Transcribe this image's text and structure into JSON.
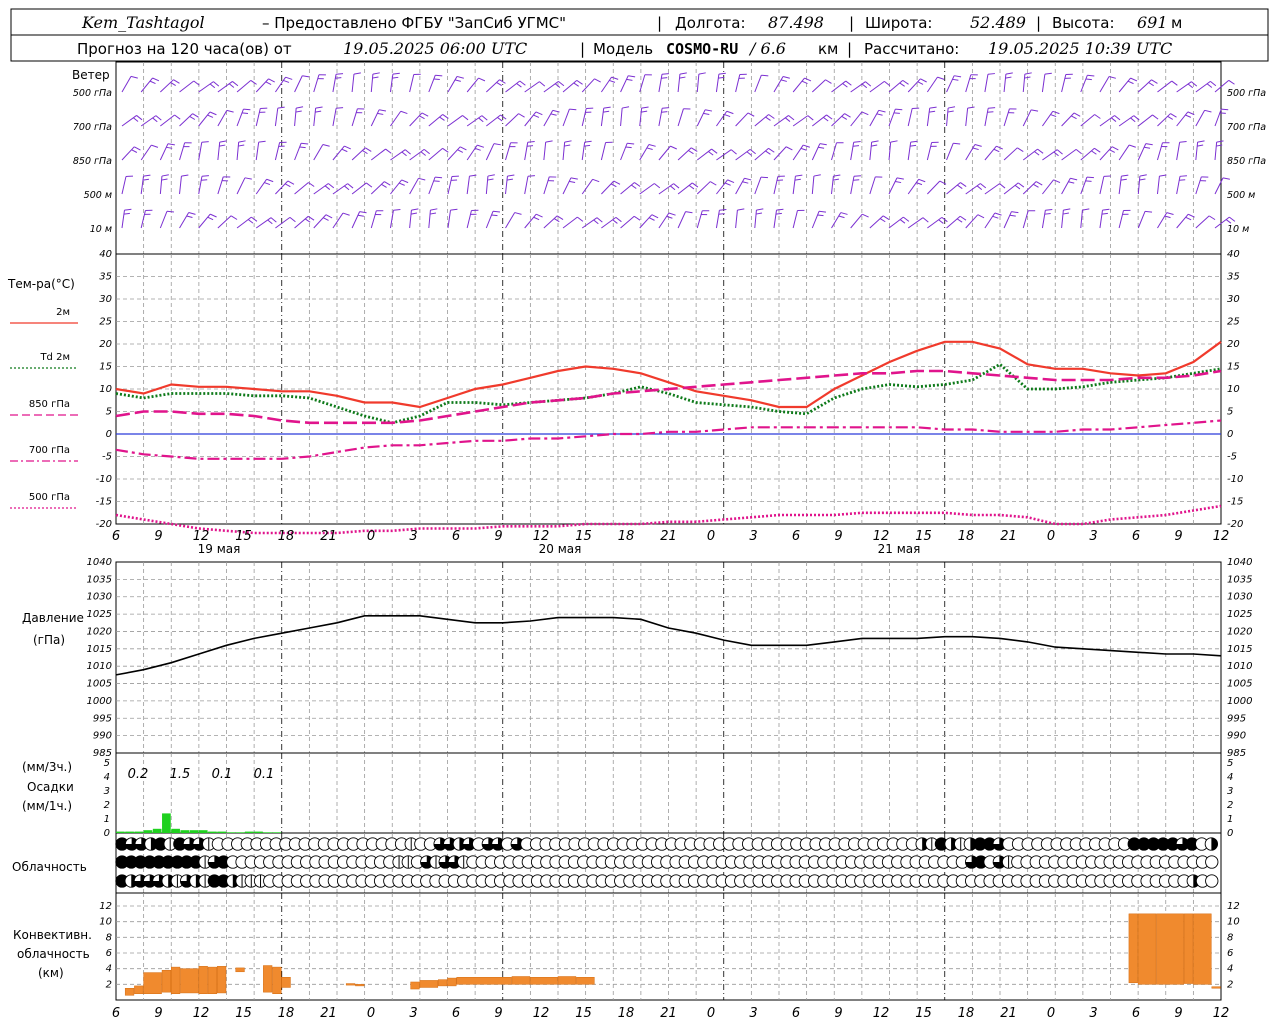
{
  "header": {
    "station": "Kem_Tashtagol",
    "provider": "– Предоставлено ФГБУ \"ЗапСиб УГМС\"",
    "lon_label": "Долгота:",
    "lon_value": "87.498",
    "lat_label": "Широта:",
    "lat_value": "52.489",
    "alt_label": "Высота:",
    "alt_value": "691",
    "alt_unit": "м",
    "forecast_prefix": "Прогноз на 120 часа(ов) от",
    "forecast_start": "19.05.2025 06:00 UTC",
    "model_label": "Модель",
    "model_name": "COSMO-RU",
    "model_res": "/ 6.6",
    "model_res_unit": "км",
    "calc_label": "Рассчитано:",
    "calc_time": "19.05.2025 10:39 UTC"
  },
  "panels": {
    "wind": {
      "title": "Ветер",
      "levels": [
        "500 гПа",
        "700 гПа",
        "850 гПа",
        "500 м",
        "10  м"
      ]
    },
    "temperature": {
      "title": "Тем-ра(°С)",
      "legend": [
        {
          "label": "2м",
          "style": "solid",
          "color": "#f03a2c"
        },
        {
          "label": "Td  2м",
          "style": "dotted-green",
          "color": "#0e7a1a"
        },
        {
          "label": "850 гПа",
          "style": "dash",
          "color": "#e0148c"
        },
        {
          "label": "700 гПа",
          "style": "dashdot",
          "color": "#e0148c"
        },
        {
          "label": "500 гПа",
          "style": "dot",
          "color": "#e0148c"
        }
      ]
    },
    "pressure": {
      "title": "Давление",
      "unit": "(гПа)"
    },
    "precip": {
      "unit_top": "(мм/3ч.)",
      "title": "Осадки",
      "unit_bottom": "(мм/1ч.)"
    },
    "cloud": {
      "title": "Облачность"
    },
    "convective": {
      "title_line1": "Конвективн.",
      "title_line2": "облачность",
      "unit": "(км)"
    }
  },
  "time_axis": {
    "hour_labels": [
      "6",
      "9",
      "12",
      "15",
      "18",
      "21",
      "0",
      "3",
      "6",
      "9",
      "12",
      "15",
      "18",
      "21",
      "0",
      "3",
      "6",
      "9",
      "12",
      "15",
      "18",
      "21",
      "0",
      "3",
      "6",
      "9",
      "12"
    ],
    "day_labels": [
      "19 мая",
      "20 мая",
      "21 мая"
    ]
  },
  "chart_data": [
    {
      "type": "line",
      "title": "Тем-ра(°С)",
      "ylim": [
        -20,
        40
      ],
      "yticks": [
        -20,
        -15,
        -10,
        -5,
        0,
        5,
        10,
        15,
        20,
        25,
        30,
        35,
        40
      ],
      "x_hours": [
        0,
        3,
        6,
        9,
        12,
        15,
        18,
        21,
        24,
        27,
        30,
        33,
        36,
        39,
        42,
        45,
        48,
        51,
        54,
        57,
        60,
        63,
        66,
        69,
        72,
        75,
        78,
        81,
        84,
        87,
        90,
        93,
        96,
        99,
        102,
        105,
        108,
        111,
        114,
        117,
        120
      ],
      "series": [
        {
          "name": "2м",
          "color": "#f03a2c",
          "style": "solid",
          "values": [
            10,
            9,
            11,
            10.5,
            10.5,
            10,
            9.5,
            9.5,
            8.5,
            7,
            7,
            6,
            8,
            10,
            11,
            12.5,
            14,
            15,
            14.5,
            13.5,
            11.5,
            9.5,
            8.5,
            7.5,
            6,
            6,
            10,
            13,
            16,
            18.5,
            20.5,
            20.5,
            19,
            15.5,
            14.5,
            14.5,
            13.5,
            13,
            13.5,
            16,
            20.5
          ]
        },
        {
          "name": "Td 2м",
          "color": "#0e7a1a",
          "style": "dotted-green",
          "values": [
            9,
            8,
            9,
            9,
            9,
            8.5,
            8.5,
            8,
            6,
            4,
            2.5,
            4,
            7,
            7,
            6.5,
            7,
            7.5,
            8,
            9,
            10.5,
            9,
            7,
            6.5,
            6,
            5,
            4.5,
            8,
            10,
            11,
            10.5,
            11,
            12,
            15.5,
            10,
            10,
            10.5,
            11.5,
            12,
            12.5,
            13.5,
            14.5
          ]
        },
        {
          "name": "850 гПа",
          "color": "#e0148c",
          "style": "dash",
          "values": [
            4,
            5,
            5,
            4.5,
            4.5,
            4,
            3,
            2.5,
            2.5,
            2.5,
            2.5,
            3,
            4,
            5,
            6,
            7,
            7.5,
            8,
            9,
            9.5,
            10,
            10.5,
            11,
            11.5,
            12,
            12.5,
            13,
            13.5,
            13.5,
            14,
            14,
            13.5,
            13,
            12.5,
            12,
            12,
            12,
            12.5,
            12.5,
            13,
            14
          ]
        },
        {
          "name": "700 гПа",
          "color": "#e0148c",
          "style": "dashdot",
          "values": [
            -3.5,
            -4.5,
            -5,
            -5.5,
            -5.5,
            -5.5,
            -5.5,
            -5,
            -4,
            -3,
            -2.5,
            -2.5,
            -2,
            -1.5,
            -1.5,
            -1,
            -1,
            -0.5,
            0,
            0,
            0.5,
            0.5,
            1,
            1.5,
            1.5,
            1.5,
            1.5,
            1.5,
            1.5,
            1.5,
            1,
            1,
            0.5,
            0.5,
            0.5,
            1,
            1,
            1.5,
            2,
            2.5,
            3
          ]
        },
        {
          "name": "500 гПа",
          "color": "#e0148c",
          "style": "dot",
          "values": [
            -18,
            -19,
            -20,
            -21,
            -21.5,
            -22,
            -22,
            -22,
            -22,
            -21.5,
            -21.5,
            -21,
            -21,
            -21,
            -20.5,
            -20.5,
            -20.5,
            -20,
            -20,
            -20,
            -19.5,
            -19.5,
            -19,
            -18.5,
            -18,
            -18,
            -18,
            -17.5,
            -17.5,
            -17.5,
            -17.5,
            -18,
            -18,
            -18.5,
            -20,
            -20,
            -19,
            -18.5,
            -18,
            -17,
            -16
          ]
        }
      ]
    },
    {
      "type": "line",
      "title": "Давление",
      "ylim": [
        985,
        1040
      ],
      "yticks": [
        985,
        990,
        995,
        1000,
        1005,
        1010,
        1015,
        1020,
        1025,
        1030,
        1035,
        1040
      ],
      "x_hours": [
        0,
        3,
        6,
        9,
        12,
        15,
        18,
        21,
        24,
        27,
        30,
        33,
        36,
        39,
        42,
        45,
        48,
        51,
        54,
        57,
        60,
        63,
        66,
        69,
        72,
        75,
        78,
        81,
        84,
        87,
        90,
        93,
        96,
        99,
        102,
        105,
        108,
        111,
        114,
        117,
        120
      ],
      "series": [
        {
          "name": "Давление",
          "color": "#000000",
          "style": "solid",
          "values": [
            1007.5,
            1009,
            1011,
            1013.5,
            1016,
            1018,
            1019.5,
            1021,
            1022.5,
            1024.5,
            1024.5,
            1024.5,
            1023.5,
            1022.5,
            1022.5,
            1023,
            1024,
            1024,
            1024,
            1023.5,
            1021,
            1019.5,
            1017.5,
            1016,
            1016,
            1016,
            1017,
            1018,
            1018,
            1018,
            1018.5,
            1018.5,
            1018,
            1017,
            1015.5,
            1015,
            1014.5,
            1014,
            1013.5,
            1013.5,
            1013
          ]
        }
      ]
    },
    {
      "type": "bar",
      "title": "Осадки",
      "ylim": [
        0,
        5
      ],
      "yticks": [
        0,
        1,
        2,
        3,
        4,
        5
      ],
      "x_hours": [
        0,
        1,
        2,
        3,
        4,
        5,
        6,
        7,
        8,
        9,
        10,
        11,
        12,
        13,
        14,
        15,
        16,
        17
      ],
      "series": [
        {
          "name": "мм/1ч.",
          "color": "#1fd11f",
          "values": [
            0.1,
            0.1,
            0.1,
            0.2,
            0.3,
            1.4,
            0.3,
            0.2,
            0.2,
            0.2,
            0.1,
            0.1,
            0.05,
            0.05,
            0.1,
            0.1,
            0.05,
            0.05
          ]
        }
      ],
      "annotations": [
        "0.2",
        "1.5",
        "0.1",
        "0.1"
      ]
    },
    {
      "type": "table",
      "title": "Облачность",
      "rows": [
        [
          4,
          3,
          3,
          2,
          4,
          1,
          4,
          3,
          3,
          1,
          0,
          0,
          0,
          0,
          0,
          0,
          0,
          0,
          0,
          0,
          0,
          0,
          0,
          0,
          0,
          0,
          0,
          0,
          0,
          0,
          1,
          0,
          0,
          3,
          3,
          2,
          3,
          0,
          3,
          3,
          0,
          3,
          0,
          0,
          0,
          0,
          0,
          0,
          0,
          0,
          0,
          0,
          0,
          0,
          0,
          0,
          0,
          0,
          0,
          0,
          0,
          0,
          0,
          0,
          0,
          0,
          0,
          0,
          0,
          0,
          0,
          0,
          0,
          0,
          0,
          0,
          0,
          0,
          0,
          0,
          0,
          0,
          0,
          2,
          1,
          4,
          2,
          1,
          2,
          4,
          4,
          3,
          0,
          0,
          0,
          0,
          0,
          0,
          0,
          0,
          0,
          0,
          0,
          0,
          0,
          4,
          4,
          4,
          4,
          4,
          3,
          4,
          0,
          2
        ],
        [
          4,
          4,
          4,
          4,
          4,
          4,
          4,
          4,
          4,
          1,
          3,
          4,
          0,
          0,
          0,
          0,
          0,
          0,
          0,
          0,
          0,
          0,
          0,
          0,
          0,
          0,
          0,
          0,
          0,
          0,
          1,
          1,
          0,
          3,
          1,
          3,
          3,
          1,
          0,
          0,
          0,
          0,
          0,
          0,
          0,
          0,
          0,
          0,
          0,
          0,
          0,
          0,
          0,
          0,
          0,
          0,
          0,
          0,
          0,
          0,
          0,
          0,
          0,
          0,
          0,
          0,
          0,
          0,
          0,
          0,
          0,
          0,
          0,
          0,
          0,
          0,
          0,
          0,
          0,
          0,
          0,
          0,
          0,
          0,
          0,
          0,
          0,
          0,
          0,
          0,
          0,
          0,
          3,
          4,
          0,
          3,
          1,
          0,
          0,
          0,
          0,
          0,
          0,
          0,
          0,
          0,
          0,
          0,
          0,
          0,
          0,
          0,
          0,
          0,
          0,
          0,
          0,
          0,
          0
        ],
        [
          4,
          2,
          3,
          3,
          3,
          2,
          1,
          3,
          2,
          1,
          4,
          4,
          2,
          1,
          1,
          1,
          0,
          0,
          0,
          0,
          0,
          0,
          0,
          0,
          0,
          0,
          0,
          0,
          0,
          0,
          0,
          0,
          0,
          0,
          0,
          0,
          0,
          0,
          0,
          0,
          0,
          0,
          0,
          0,
          0,
          0,
          0,
          0,
          0,
          0,
          0,
          0,
          0,
          0,
          0,
          0,
          0,
          0,
          0,
          0,
          0,
          0,
          0,
          0,
          0,
          0,
          0,
          0,
          0,
          0,
          0,
          0,
          0,
          0,
          0,
          0,
          0,
          0,
          0,
          0,
          0,
          0,
          0,
          0,
          0,
          0,
          0,
          0,
          0,
          0,
          0,
          0,
          0,
          0,
          0,
          0,
          0,
          0,
          0,
          0,
          0,
          0,
          0,
          0,
          0,
          0,
          0,
          0,
          0,
          0,
          0,
          0,
          0,
          0,
          0,
          0,
          2,
          0,
          0
        ]
      ]
    },
    {
      "type": "bar",
      "title": "Конвективн. облачность",
      "ylim": [
        0,
        12
      ],
      "yticks": [
        2,
        4,
        6,
        8,
        10,
        12
      ],
      "segments": [
        [
          1,
          2,
          0.6,
          1.5
        ],
        [
          2,
          3,
          0.8,
          1.8
        ],
        [
          3,
          5,
          0.8,
          3.5
        ],
        [
          5,
          6,
          1,
          3.8
        ],
        [
          6,
          7,
          0.8,
          4.2
        ],
        [
          7,
          9,
          0.9,
          4
        ],
        [
          9,
          10,
          0.8,
          4.3
        ],
        [
          10,
          11,
          0.8,
          4.2
        ],
        [
          11,
          12,
          0.9,
          4.3
        ],
        [
          13,
          14,
          3.6,
          4.1
        ],
        [
          16,
          17,
          1,
          4.4
        ],
        [
          17,
          18,
          0.8,
          4.2
        ],
        [
          18,
          19,
          1.6,
          2.9
        ],
        [
          25,
          26,
          1.9,
          2.1
        ],
        [
          26,
          27,
          1.8,
          2
        ],
        [
          32,
          33,
          1.4,
          2.3
        ],
        [
          33,
          35,
          1.6,
          2.5
        ],
        [
          35,
          36,
          1.8,
          2.6
        ],
        [
          36,
          37,
          1.8,
          2.8
        ],
        [
          37,
          43,
          2,
          2.9
        ],
        [
          43,
          45,
          2,
          3
        ],
        [
          45,
          48,
          2,
          2.9
        ],
        [
          48,
          50,
          2,
          3
        ],
        [
          50,
          52,
          2,
          2.9
        ],
        [
          110,
          111,
          2.2,
          11
        ],
        [
          111,
          113,
          2,
          11
        ],
        [
          113,
          116,
          2,
          11
        ],
        [
          116,
          117,
          2.1,
          11
        ],
        [
          117,
          119,
          2,
          11
        ],
        [
          119,
          120,
          1.5,
          1.7
        ]
      ]
    }
  ]
}
